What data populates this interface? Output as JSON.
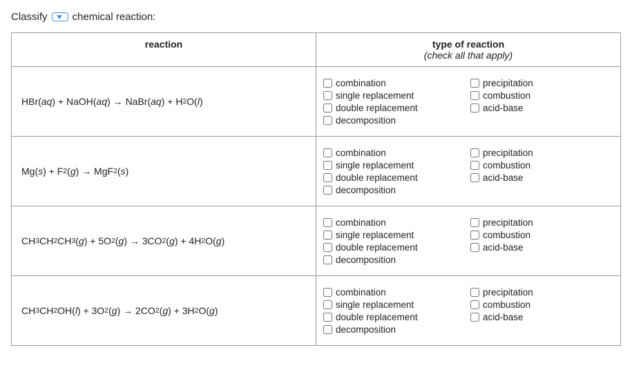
{
  "header": {
    "classify_label": "Classify",
    "rest_label": "chemical reaction:"
  },
  "table": {
    "col1_header": "reaction",
    "col2_header": "type of reaction",
    "col2_subheader": "(check all that apply)",
    "rows": [
      {
        "id": "row1",
        "reaction_html": "HBr(<i>aq</i>) + NaOH(<i>aq</i>) → NaBr(<i>aq</i>) + H<sub>2</sub>O(<i>l</i>)"
      },
      {
        "id": "row2",
        "reaction_html": "Mg(<i>s</i>) + F<sub>2</sub>(<i>g</i>) → MgF<sub>2</sub>(<i>s</i>)"
      },
      {
        "id": "row3",
        "reaction_html": "CH<sub>3</sub>CH<sub>2</sub>CH<sub>3</sub>(<i>g</i>) + 5O<sub>2</sub>(<i>g</i>) → 3CO<sub>2</sub>(<i>g</i>) + 4H<sub>2</sub>O(<i>g</i>)"
      },
      {
        "id": "row4",
        "reaction_html": "CH<sub>3</sub>CH<sub>2</sub>OH(<i>l</i>) + 3O<sub>2</sub>(<i>g</i>) → 2CO<sub>2</sub>(<i>g</i>) + 3H<sub>2</sub>O(<i>g</i>)"
      }
    ],
    "checkboxes": [
      {
        "id": "combination",
        "label": "combination"
      },
      {
        "id": "precipitation",
        "label": "precipitation"
      },
      {
        "id": "single_replacement",
        "label": "single replacement"
      },
      {
        "id": "combustion",
        "label": "combustion"
      },
      {
        "id": "double_replacement",
        "label": "double replacement"
      },
      {
        "id": "acid_base",
        "label": "acid-base"
      },
      {
        "id": "decomposition",
        "label": "decomposition"
      }
    ]
  }
}
